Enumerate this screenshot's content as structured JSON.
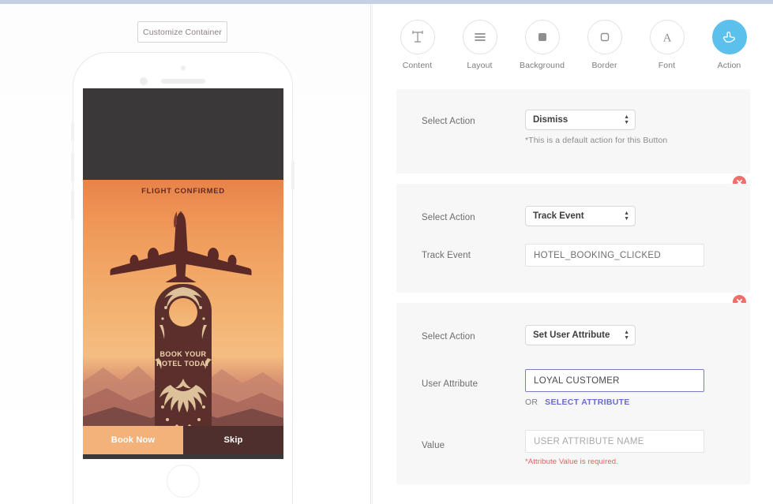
{
  "left": {
    "customize_button": "Customize Container",
    "preview": {
      "header_text": "FLIGHT CONFIRMED",
      "tag_line1": "BOOK YOUR",
      "tag_line2": "HOTEL TODAY",
      "primary_cta": "Book Now",
      "secondary_cta": "Skip"
    }
  },
  "toolbar": {
    "items": [
      {
        "label": "Content",
        "icon": "text-format-icon",
        "active": false
      },
      {
        "label": "Layout",
        "icon": "lines-layout-icon",
        "active": false
      },
      {
        "label": "Background",
        "icon": "filled-square-icon",
        "active": false
      },
      {
        "label": "Border",
        "icon": "outline-square-icon",
        "active": false
      },
      {
        "label": "Font",
        "icon": "letter-a-icon",
        "active": false
      },
      {
        "label": "Action",
        "icon": "pointing-hand-icon",
        "active": true
      }
    ]
  },
  "cards": [
    {
      "select_action_label": "Select Action",
      "select_action_value": "Dismiss",
      "options": [
        "Dismiss",
        "Track Event",
        "Set User Attribute"
      ],
      "hint": "*This is a default action for this Button",
      "deletable": false
    },
    {
      "select_action_label": "Select Action",
      "select_action_value": "Track Event",
      "options": [
        "Dismiss",
        "Track Event",
        "Set User Attribute"
      ],
      "field_label": "Track Event",
      "field_value": "HOTEL_BOOKING_CLICKED",
      "deletable": true
    },
    {
      "select_action_label": "Select Action",
      "select_action_value": "Set User Attribute",
      "options": [
        "Dismiss",
        "Track Event",
        "Set User Attribute"
      ],
      "attribute_label": "User Attribute",
      "attribute_value": "LOYAL CUSTOMER",
      "or_text": "OR",
      "select_attribute_link": "SELECT ATTRIBUTE",
      "value_label": "Value",
      "value_placeholder": "USER ATTRIBUTE NAME",
      "value_error": "*Attribute Value is required.",
      "deletable": true
    }
  ],
  "colors": {
    "accent_blue": "#5bc0ec",
    "delete_red": "#ef6f6b",
    "link_purple": "#6a6ad1",
    "error_red": "#e2605c",
    "topbar": "#c6d0e4"
  }
}
